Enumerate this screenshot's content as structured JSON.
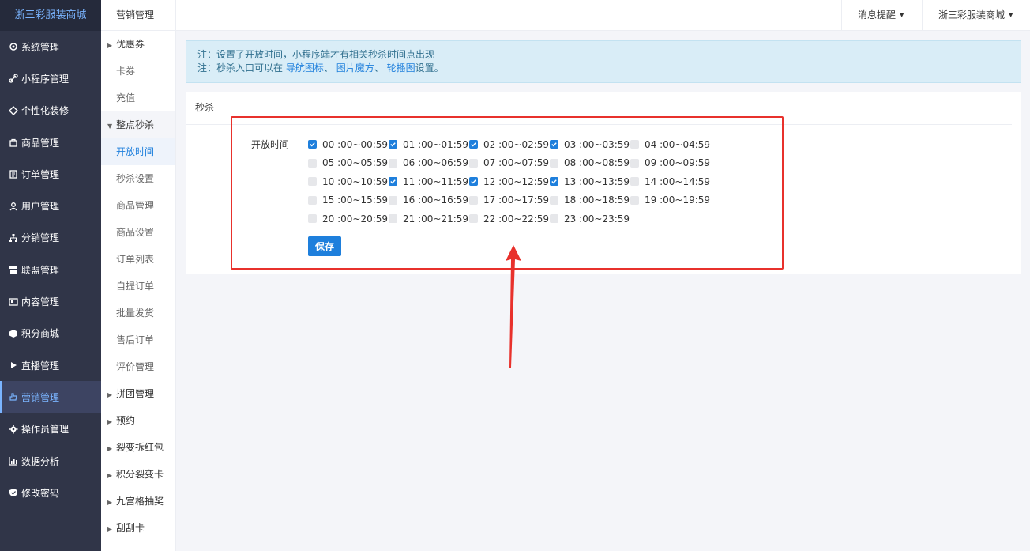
{
  "sidebar": {
    "brand": "浙三彩服装商城",
    "items": [
      {
        "label": "系统管理",
        "icon": "gear-icon"
      },
      {
        "label": "小程序管理",
        "icon": "link-icon"
      },
      {
        "label": "个性化装修",
        "icon": "diamond-icon"
      },
      {
        "label": "商品管理",
        "icon": "bag-icon"
      },
      {
        "label": "订单管理",
        "icon": "clipboard-icon"
      },
      {
        "label": "用户管理",
        "icon": "user-icon"
      },
      {
        "label": "分销管理",
        "icon": "network-icon"
      },
      {
        "label": "联盟管理",
        "icon": "store-icon"
      },
      {
        "label": "内容管理",
        "icon": "content-icon"
      },
      {
        "label": "积分商城",
        "icon": "cube-icon"
      },
      {
        "label": "直播管理",
        "icon": "play-icon"
      },
      {
        "label": "营销管理",
        "icon": "hand-icon",
        "active": true
      },
      {
        "label": "操作员管理",
        "icon": "cog-icon"
      },
      {
        "label": "数据分析",
        "icon": "chart-icon"
      },
      {
        "label": "修改密码",
        "icon": "shield-icon"
      }
    ]
  },
  "submenu": {
    "title": "营销管理",
    "items": [
      {
        "label": "优惠券",
        "type": "group"
      },
      {
        "label": "卡券",
        "type": "child"
      },
      {
        "label": "充值",
        "type": "child"
      },
      {
        "label": "整点秒杀",
        "type": "open-group"
      },
      {
        "label": "开放时间",
        "type": "current"
      },
      {
        "label": "秒杀设置",
        "type": "child"
      },
      {
        "label": "商品管理",
        "type": "child"
      },
      {
        "label": "商品设置",
        "type": "child"
      },
      {
        "label": "订单列表",
        "type": "child"
      },
      {
        "label": "自提订单",
        "type": "child"
      },
      {
        "label": "批量发货",
        "type": "child"
      },
      {
        "label": "售后订单",
        "type": "child"
      },
      {
        "label": "评价管理",
        "type": "child"
      },
      {
        "label": "拼团管理",
        "type": "group"
      },
      {
        "label": "预约",
        "type": "group"
      },
      {
        "label": "裂变拆红包",
        "type": "group"
      },
      {
        "label": "积分裂变卡",
        "type": "group"
      },
      {
        "label": "九宫格抽奖",
        "type": "group"
      },
      {
        "label": "刮刮卡",
        "type": "group"
      }
    ]
  },
  "header": {
    "notifications_label": "消息提醒",
    "shop_label": "浙三彩服装商城"
  },
  "notice": {
    "line1": "注：设置了开放时间，小程序端才有相关秒杀时间点出现",
    "line2_prefix": "注：秒杀入口可以在",
    "link_nav_icon": "导航图标",
    "sep1": "、",
    "link_picture_cube": "图片魔方",
    "sep2": "、",
    "link_carousel": "轮播图",
    "line2_suffix": "设置。"
  },
  "panel": {
    "title": "秒杀",
    "field_label": "开放时间",
    "save_label": "保存",
    "slots": [
      {
        "label": "00 :00~00:59",
        "checked": true
      },
      {
        "label": "01 :00~01:59",
        "checked": true
      },
      {
        "label": "02 :00~02:59",
        "checked": true
      },
      {
        "label": "03 :00~03:59",
        "checked": true
      },
      {
        "label": "04 :00~04:59",
        "checked": false
      },
      {
        "label": "05 :00~05:59",
        "checked": false
      },
      {
        "label": "06 :00~06:59",
        "checked": false
      },
      {
        "label": "07 :00~07:59",
        "checked": false
      },
      {
        "label": "08 :00~08:59",
        "checked": false
      },
      {
        "label": "09 :00~09:59",
        "checked": false
      },
      {
        "label": "10 :00~10:59",
        "checked": false
      },
      {
        "label": "11 :00~11:59",
        "checked": true
      },
      {
        "label": "12 :00~12:59",
        "checked": true
      },
      {
        "label": "13 :00~13:59",
        "checked": true
      },
      {
        "label": "14 :00~14:59",
        "checked": false
      },
      {
        "label": "15 :00~15:59",
        "checked": false
      },
      {
        "label": "16 :00~16:59",
        "checked": false
      },
      {
        "label": "17 :00~17:59",
        "checked": false
      },
      {
        "label": "18 :00~18:59",
        "checked": false
      },
      {
        "label": "19 :00~19:59",
        "checked": false
      },
      {
        "label": "20 :00~20:59",
        "checked": false
      },
      {
        "label": "21 :00~21:59",
        "checked": false
      },
      {
        "label": "22 :00~22:59",
        "checked": false
      },
      {
        "label": "23 :00~23:59",
        "checked": false
      }
    ]
  },
  "colors": {
    "accent": "#1e7fdc",
    "sidebar_bg": "#303548",
    "annotation_red": "#e8312c"
  }
}
